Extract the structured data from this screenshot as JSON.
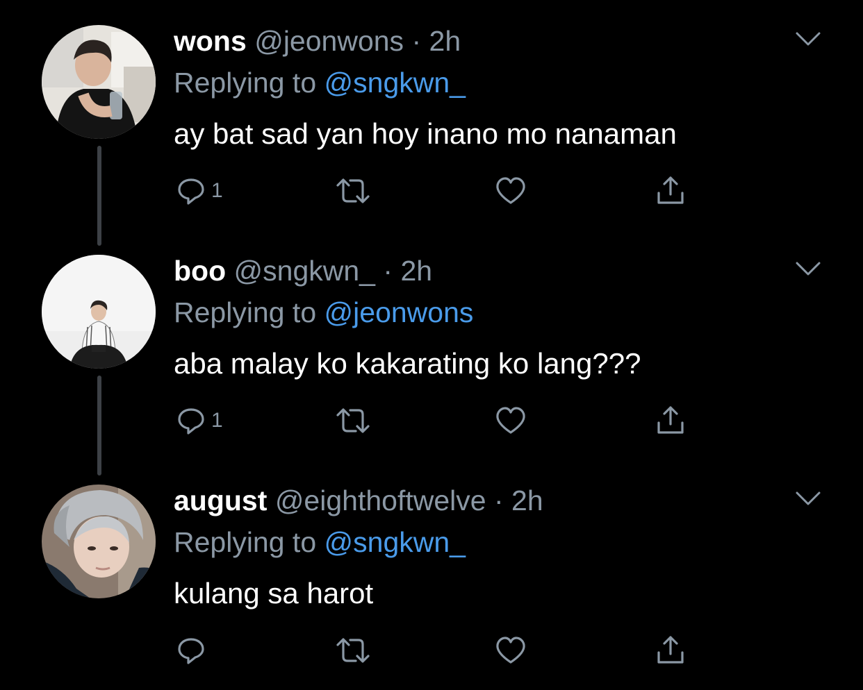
{
  "theme": {
    "background": "#000000",
    "text": "#ffffff",
    "muted": "#8b98a5",
    "link": "#4a9bea",
    "thread_line": "#3d4146"
  },
  "tweets": [
    {
      "display_name": "wons",
      "handle": "@jeonwons",
      "separator": "·",
      "time": "2h",
      "replying_prefix": "Replying to",
      "replying_to": "@sngkwn_",
      "text": "ay bat sad yan hoy inano mo nanaman",
      "reply_count": "1",
      "avatar_icon": "profile-photo"
    },
    {
      "display_name": "boo",
      "handle": "@sngkwn_",
      "separator": "·",
      "time": "2h",
      "replying_prefix": "Replying to",
      "replying_to": "@jeonwons",
      "text": "aba malay ko kakarating ko lang???",
      "reply_count": "1",
      "avatar_icon": "profile-photo"
    },
    {
      "display_name": "august",
      "handle": "@eighthoftwelve",
      "separator": "·",
      "time": "2h",
      "replying_prefix": "Replying to",
      "replying_to": "@sngkwn_",
      "text": "kulang sa harot",
      "reply_count": "",
      "avatar_icon": "profile-photo"
    }
  ],
  "action_icons": [
    "reply-icon",
    "retweet-icon",
    "like-icon",
    "share-icon"
  ],
  "menu_icon": "chevron-down-icon"
}
